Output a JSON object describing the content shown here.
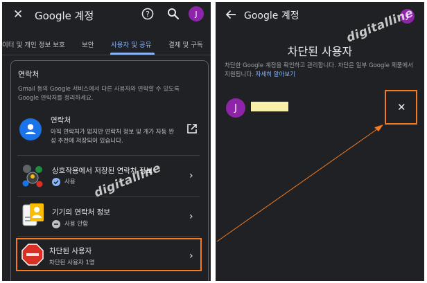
{
  "left_screen": {
    "header": {
      "title": "Google 계정",
      "avatar_letter": "J"
    },
    "tabs": [
      {
        "label": "이터 및 개인 정보 보호"
      },
      {
        "label": "보안"
      },
      {
        "label": "사용자 및 공유",
        "active": true
      },
      {
        "label": "결제 및 구독"
      }
    ],
    "contacts_section": {
      "title": "연락처",
      "description": "Gmail 등의 Google 서비스에서 다른 사용자와 연락할 수 있도록 Google 연락처를 정리하세요.",
      "rows": [
        {
          "title": "연락처",
          "subtitle": "아직 연락처가 없지만 연락처 정보 및 개가 자동 완성 추천에 저장되어 있습니다.",
          "icon": "person-icon",
          "action_icon": "open-in-new-icon"
        },
        {
          "title": "상호작용에서 저장된 연락처 정보",
          "status": "사용",
          "status_icon": "check-circle-icon",
          "icon": "interactions-illustration"
        },
        {
          "title": "기기의 연락처 정보",
          "status": "사용 안함",
          "status_icon": "minus-circle-icon",
          "icon": "device-contacts-illustration"
        },
        {
          "title": "차단된 사용자",
          "status": "차단된 사용자 1명",
          "icon": "stop-sign-illustration"
        }
      ]
    }
  },
  "right_screen": {
    "header": {
      "title": "Google 계정",
      "avatar_letter": "J"
    },
    "page_title": "차단된 사용자",
    "description": "차단한 Google 계정을 확인하고 관리합니다. 차단은 일부 Google 제품에서 지원됩니다.",
    "learn_more": "자세히 알아보기",
    "blocked_users": [
      {
        "avatar_letter": "J"
      }
    ]
  },
  "watermark": "digitalline",
  "colors": {
    "background": "#202124",
    "accent": "#8ab4f8",
    "avatar": "#8e24aa",
    "highlight": "#f47b20"
  }
}
